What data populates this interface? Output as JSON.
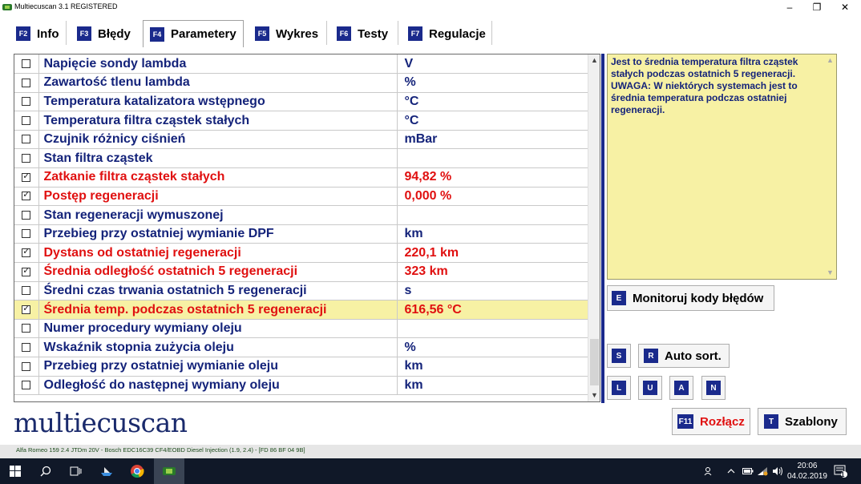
{
  "window": {
    "title": "Multiecuscan 3.1 REGISTERED",
    "minimize": "–",
    "maximize": "❐",
    "close": "✕"
  },
  "tabs": [
    {
      "key": "F2",
      "label": "Info",
      "active": false
    },
    {
      "key": "F3",
      "label": "Błędy",
      "active": false
    },
    {
      "key": "F4",
      "label": "Parametery",
      "active": true
    },
    {
      "key": "F5",
      "label": "Wykres",
      "active": false
    },
    {
      "key": "F6",
      "label": "Testy",
      "active": false
    },
    {
      "key": "F7",
      "label": "Regulacje",
      "active": false
    }
  ],
  "parameters": [
    {
      "name": "Napięcie sondy lambda",
      "value": "V",
      "checked": false,
      "highlighted": false
    },
    {
      "name": "Zawartość tlenu lambda",
      "value": "%",
      "checked": false,
      "highlighted": false
    },
    {
      "name": "Temperatura katalizatora wstępnego",
      "value": "°C",
      "checked": false,
      "highlighted": false
    },
    {
      "name": "Temperatura filtra cząstek stałych",
      "value": "°C",
      "checked": false,
      "highlighted": false
    },
    {
      "name": "Czujnik różnicy ciśnień",
      "value": "mBar",
      "checked": false,
      "highlighted": false
    },
    {
      "name": "Stan filtra cząstek",
      "value": "",
      "checked": false,
      "highlighted": false
    },
    {
      "name": "Zatkanie filtra cząstek stałych",
      "value": "94,82 %",
      "checked": true,
      "highlighted": false
    },
    {
      "name": "Postęp regeneracji",
      "value": "0,000 %",
      "checked": true,
      "highlighted": false
    },
    {
      "name": "Stan regeneracji wymuszonej",
      "value": "",
      "checked": false,
      "highlighted": false
    },
    {
      "name": "Przebieg przy ostatniej wymianie DPF",
      "value": "km",
      "checked": false,
      "highlighted": false
    },
    {
      "name": "Dystans od ostatniej regeneracji",
      "value": "220,1 km",
      "checked": true,
      "highlighted": false
    },
    {
      "name": "Średnia odległość ostatnich 5 regeneracji",
      "value": "323 km",
      "checked": true,
      "highlighted": false
    },
    {
      "name": "Średni czas trwania ostatnich 5 regeneracji",
      "value": "s",
      "checked": false,
      "highlighted": false
    },
    {
      "name": "Średnia temp. podczas ostatnich 5 regeneracji",
      "value": "616,56 °C",
      "checked": true,
      "highlighted": true
    },
    {
      "name": "Numer procedury wymiany oleju",
      "value": "",
      "checked": false,
      "highlighted": false
    },
    {
      "name": "Wskaźnik stopnia zużycia oleju",
      "value": "%",
      "checked": false,
      "highlighted": false
    },
    {
      "name": "Przebieg przy ostatniej wymianie oleju",
      "value": "km",
      "checked": false,
      "highlighted": false
    },
    {
      "name": "Odległość do następnej wymiany oleju",
      "value": "km",
      "checked": false,
      "highlighted": false
    }
  ],
  "description": {
    "text": "Jest to średnia temperatura filtra cząstek stałych podczas ostatnich 5 regeneracji. UWAGA: W niektórych systemach jest to średnia temperatura podczas ostatniej regeneracji."
  },
  "buttons": {
    "monitor": {
      "key": "E",
      "label": "Monitoruj kody błędów"
    },
    "s": {
      "key": "S"
    },
    "autosort": {
      "key": "R",
      "label": "Auto sort."
    },
    "l": {
      "key": "L"
    },
    "u": {
      "key": "U"
    },
    "a": {
      "key": "A"
    },
    "n": {
      "key": "N"
    },
    "disconnect": {
      "key": "F11",
      "label": "Rozłącz"
    },
    "templates": {
      "key": "T",
      "label": "Szablony"
    }
  },
  "logo": {
    "text": "multiecuscan"
  },
  "status": {
    "text": "Alfa Romeo 159 2.4 JTDm 20V - Bosch EDC16C39 CF4/EOBD Diesel Injection (1.9, 2.4) - [FD 86 BF 04 9B]"
  },
  "colors": {
    "key_badge": "#1a2a8c",
    "text_blue": "#14237a",
    "text_red": "#e01010",
    "highlight": "#f7f1a4",
    "taskbar": "#101828"
  },
  "taskbar": {
    "time": "20:06",
    "date": "04.02.2019",
    "notifications": "1",
    "icons": [
      "windows-start-icon",
      "search-icon",
      "task-view-icon",
      "ship-icon",
      "chrome-icon",
      "multiecuscan-icon"
    ]
  }
}
